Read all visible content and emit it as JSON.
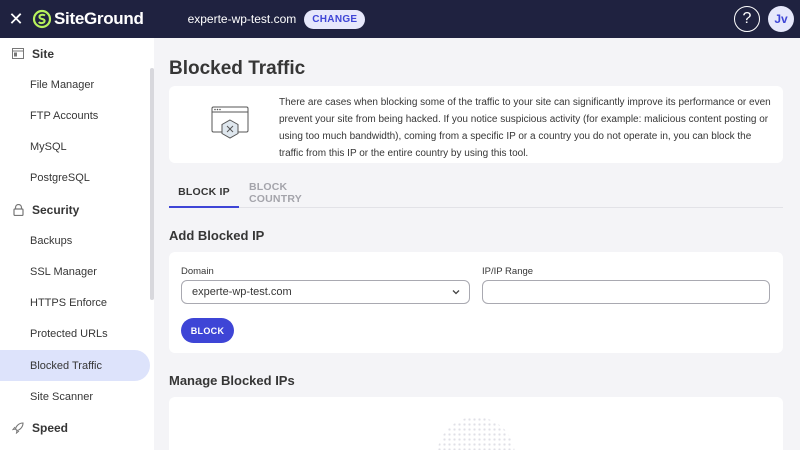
{
  "topbar": {
    "logo_text": "SiteGround",
    "domain": "experte-wp-test.com",
    "change_label": "CHANGE",
    "help_label": "?",
    "avatar_initials": "Jv"
  },
  "sidebar": {
    "items": [
      {
        "label": "Site",
        "type": "section",
        "icon": "site-icon"
      },
      {
        "label": "File Manager",
        "type": "item"
      },
      {
        "label": "FTP Accounts",
        "type": "item"
      },
      {
        "label": "MySQL",
        "type": "item"
      },
      {
        "label": "PostgreSQL",
        "type": "item"
      },
      {
        "label": "Security",
        "type": "section",
        "icon": "lock-icon"
      },
      {
        "label": "Backups",
        "type": "item"
      },
      {
        "label": "SSL Manager",
        "type": "item"
      },
      {
        "label": "HTTPS Enforce",
        "type": "item"
      },
      {
        "label": "Protected URLs",
        "type": "item"
      },
      {
        "label": "Blocked Traffic",
        "type": "item",
        "active": true
      },
      {
        "label": "Site Scanner",
        "type": "item"
      },
      {
        "label": "Speed",
        "type": "section",
        "icon": "rocket-icon"
      }
    ]
  },
  "main": {
    "title": "Blocked Traffic",
    "info_text": "There are cases when blocking some of the traffic to your site can significantly improve its performance or even prevent your site from being hacked. If you notice suspicious activity (for example: malicious content posting or using too much bandwidth), coming from a specific IP or a country you do not operate in, you can block the traffic from this IP or the entire country by using this tool.",
    "tabs": [
      {
        "label": "BLOCK IP",
        "active": true
      },
      {
        "label": "BLOCK COUNTRY",
        "active": false
      }
    ],
    "add_section_title": "Add Blocked IP",
    "domain_label": "Domain",
    "domain_value": "experte-wp-test.com",
    "ip_label": "IP/IP Range",
    "ip_value": "",
    "block_label": "BLOCK",
    "manage_section_title": "Manage Blocked IPs"
  },
  "colors": {
    "topbar_bg": "#1f2240",
    "accent": "#3e45d6",
    "active_nav_bg": "#dde3fb",
    "page_bg": "#f4f4f7"
  }
}
